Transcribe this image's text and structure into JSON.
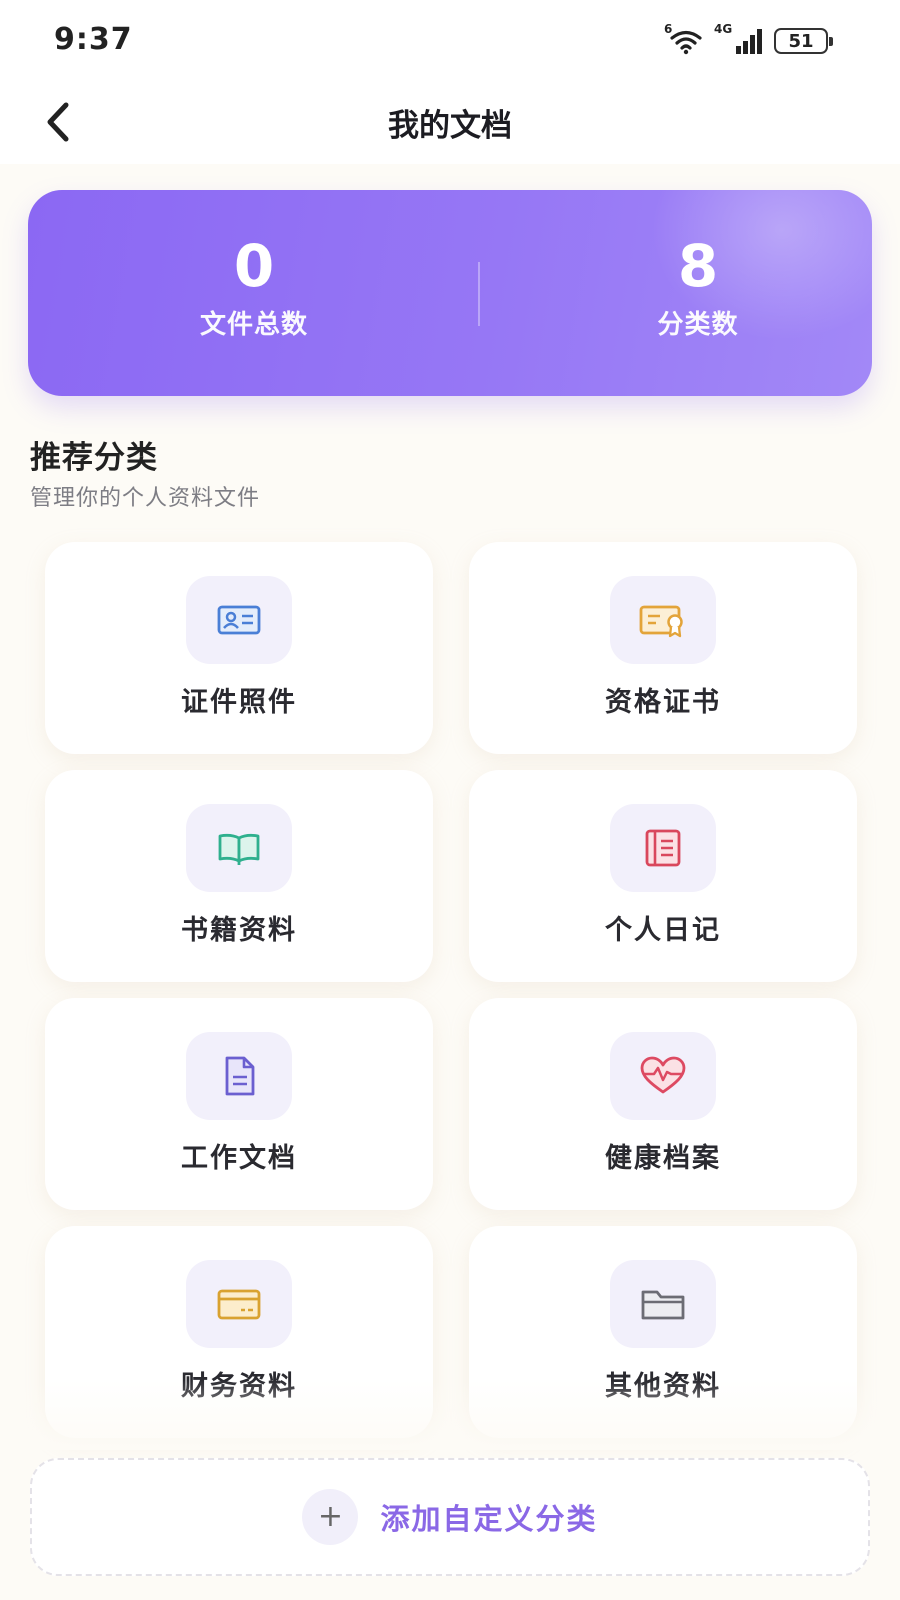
{
  "status_bar": {
    "time": "9:37",
    "wifi_badge": "6",
    "network_type": "4G",
    "battery_level": "51"
  },
  "header": {
    "back_icon": "chevron-left-icon",
    "title": "我的文档"
  },
  "stats": {
    "total_files_value": "0",
    "total_files_label": "文件总数",
    "categories_value": "8",
    "categories_label": "分类数"
  },
  "section": {
    "title": "推荐分类",
    "subtitle": "管理你的个人资料文件"
  },
  "categories": [
    {
      "label": "证件照件",
      "icon": "id-card-icon",
      "color": "#4a7fd6"
    },
    {
      "label": "资格证书",
      "icon": "certificate-icon",
      "color": "#e3a43a"
    },
    {
      "label": "书籍资料",
      "icon": "book-icon",
      "color": "#2fb08e"
    },
    {
      "label": "个人日记",
      "icon": "diary-icon",
      "color": "#d9475c"
    },
    {
      "label": "工作文档",
      "icon": "document-icon",
      "color": "#6b5fd0"
    },
    {
      "label": "健康档案",
      "icon": "heart-pulse-icon",
      "color": "#dd4a62"
    },
    {
      "label": "财务资料",
      "icon": "credit-card-icon",
      "color": "#d9a230"
    },
    {
      "label": "其他资料",
      "icon": "folder-icon",
      "color": "#6c6c74"
    }
  ],
  "add_button": {
    "icon": "plus-icon",
    "plus_glyph": "+",
    "label": "添加自定义分类"
  },
  "colors": {
    "accent": "#8b68f3",
    "add_label": "#8a68e6",
    "background": "#fdfbf6"
  }
}
